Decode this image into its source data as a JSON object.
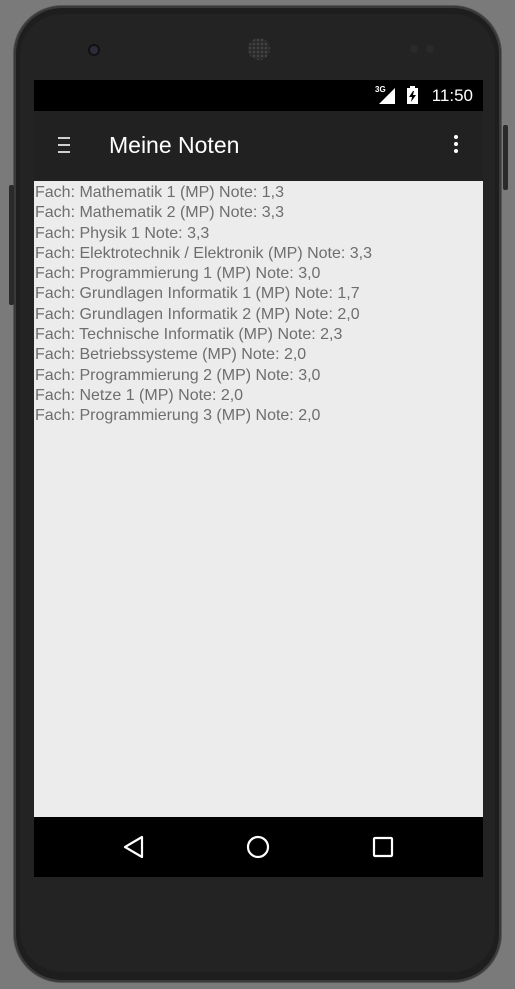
{
  "status_bar": {
    "network_type": "3G",
    "time": "11:50",
    "icons": [
      "signal-icon",
      "battery-charging-icon"
    ]
  },
  "app_bar": {
    "title": "Meine Noten",
    "icons": [
      "menu-icon",
      "overflow-menu-icon"
    ]
  },
  "grades": [
    "Fach: Mathematik 1 (MP) Note: 1,3",
    "Fach: Mathematik 2 (MP) Note: 3,3",
    "Fach: Physik 1 Note: 3,3",
    "Fach: Elektrotechnik / Elektronik (MP) Note: 3,3",
    "Fach: Programmierung 1 (MP) Note: 3,0",
    "Fach: Grundlagen Informatik 1 (MP) Note: 1,7",
    "Fach: Grundlagen Informatik 2 (MP) Note: 2,0",
    "Fach: Technische Informatik (MP) Note: 2,3",
    "Fach: Betriebssysteme (MP) Note: 2,0",
    "Fach: Programmierung 2 (MP) Note: 3,0",
    "Fach: Netze 1 (MP) Note: 2,0",
    "Fach: Programmierung 3 (MP) Note: 2,0"
  ],
  "nav_bar": {
    "icons": [
      "back-icon",
      "home-icon",
      "recents-icon"
    ]
  },
  "colors": {
    "app_bar": "#212121",
    "content_background": "#ececec",
    "list_text": "#6e6e6e"
  }
}
